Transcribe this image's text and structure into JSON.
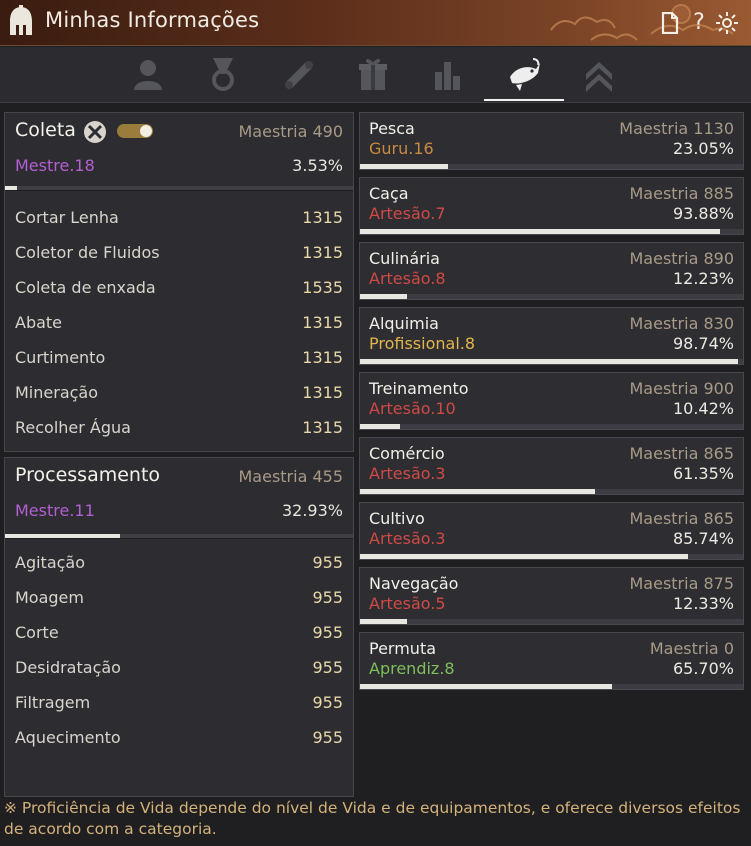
{
  "window": {
    "title": "Minhas Informações",
    "help_label": "?"
  },
  "tabs": [
    {
      "name": "profile-tab",
      "icon": "person-icon",
      "active": false
    },
    {
      "name": "medal-tab",
      "icon": "medal-icon",
      "active": false
    },
    {
      "name": "scroll-tab",
      "icon": "scroll-icon",
      "active": false
    },
    {
      "name": "gift-tab",
      "icon": "gift-icon",
      "active": false
    },
    {
      "name": "stats-tab",
      "icon": "bar-chart-icon",
      "active": false
    },
    {
      "name": "life-skill-tab",
      "icon": "fish-icon",
      "active": true
    },
    {
      "name": "rank-tab",
      "icon": "double-chevron-up-icon",
      "active": false
    }
  ],
  "gathering": {
    "name": "Coleta",
    "mastery": "Maestria 490",
    "rank": "Mestre.18",
    "percent": "3.53%",
    "progress": 0.0353,
    "toggle_on": true,
    "skills": [
      {
        "name": "Cortar Lenha",
        "value": "1315"
      },
      {
        "name": "Coletor de Fluidos",
        "value": "1315"
      },
      {
        "name": "Coleta de enxada",
        "value": "1535"
      },
      {
        "name": "Abate",
        "value": "1315"
      },
      {
        "name": "Curtimento",
        "value": "1315"
      },
      {
        "name": "Mineração",
        "value": "1315"
      },
      {
        "name": "Recolher Água",
        "value": "1315"
      }
    ]
  },
  "processing": {
    "name": "Processamento",
    "mastery": "Maestria 455",
    "rank": "Mestre.11",
    "percent": "32.93%",
    "progress": 0.3293,
    "skills": [
      {
        "name": "Agitação",
        "value": "955"
      },
      {
        "name": "Moagem",
        "value": "955"
      },
      {
        "name": "Corte",
        "value": "955"
      },
      {
        "name": "Desidratação",
        "value": "955"
      },
      {
        "name": "Filtragem",
        "value": "955"
      },
      {
        "name": "Aquecimento",
        "value": "955"
      }
    ]
  },
  "life_skills": [
    {
      "name": "Pesca",
      "mastery": "Maestria 1130",
      "rank": "Guru.16",
      "rank_color": "#c98a3e",
      "percent": "23.05%",
      "progress": 0.2305
    },
    {
      "name": "Caça",
      "mastery": "Maestria 885",
      "rank": "Artesão.7",
      "rank_color": "#cf4a45",
      "percent": "93.88%",
      "progress": 0.9388
    },
    {
      "name": "Culinária",
      "mastery": "Maestria 890",
      "rank": "Artesão.8",
      "rank_color": "#cf4a45",
      "percent": "12.23%",
      "progress": 0.1223
    },
    {
      "name": "Alquimia",
      "mastery": "Maestria 830",
      "rank": "Profissional.8",
      "rank_color": "#e2b64b",
      "percent": "98.74%",
      "progress": 0.9874
    },
    {
      "name": "Treinamento",
      "mastery": "Maestria 900",
      "rank": "Artesão.10",
      "rank_color": "#cf4a45",
      "percent": "10.42%",
      "progress": 0.1042
    },
    {
      "name": "Comércio",
      "mastery": "Maestria 865",
      "rank": "Artesão.3",
      "rank_color": "#cf4a45",
      "percent": "61.35%",
      "progress": 0.6135
    },
    {
      "name": "Cultivo",
      "mastery": "Maestria 865",
      "rank": "Artesão.3",
      "rank_color": "#cf4a45",
      "percent": "85.74%",
      "progress": 0.8574
    },
    {
      "name": "Navegação",
      "mastery": "Maestria 875",
      "rank": "Artesão.5",
      "rank_color": "#cf4a45",
      "percent": "12.33%",
      "progress": 0.1233
    },
    {
      "name": "Permuta",
      "mastery": "Maestria 0",
      "rank": "Aprendiz.8",
      "rank_color": "#7fbf5a",
      "percent": "65.70%",
      "progress": 0.657
    }
  ],
  "footnote": "※ Proficiência de Vida depende do nível de Vida e de equipamentos, e oferece diversos efeitos de acordo com a categoria."
}
